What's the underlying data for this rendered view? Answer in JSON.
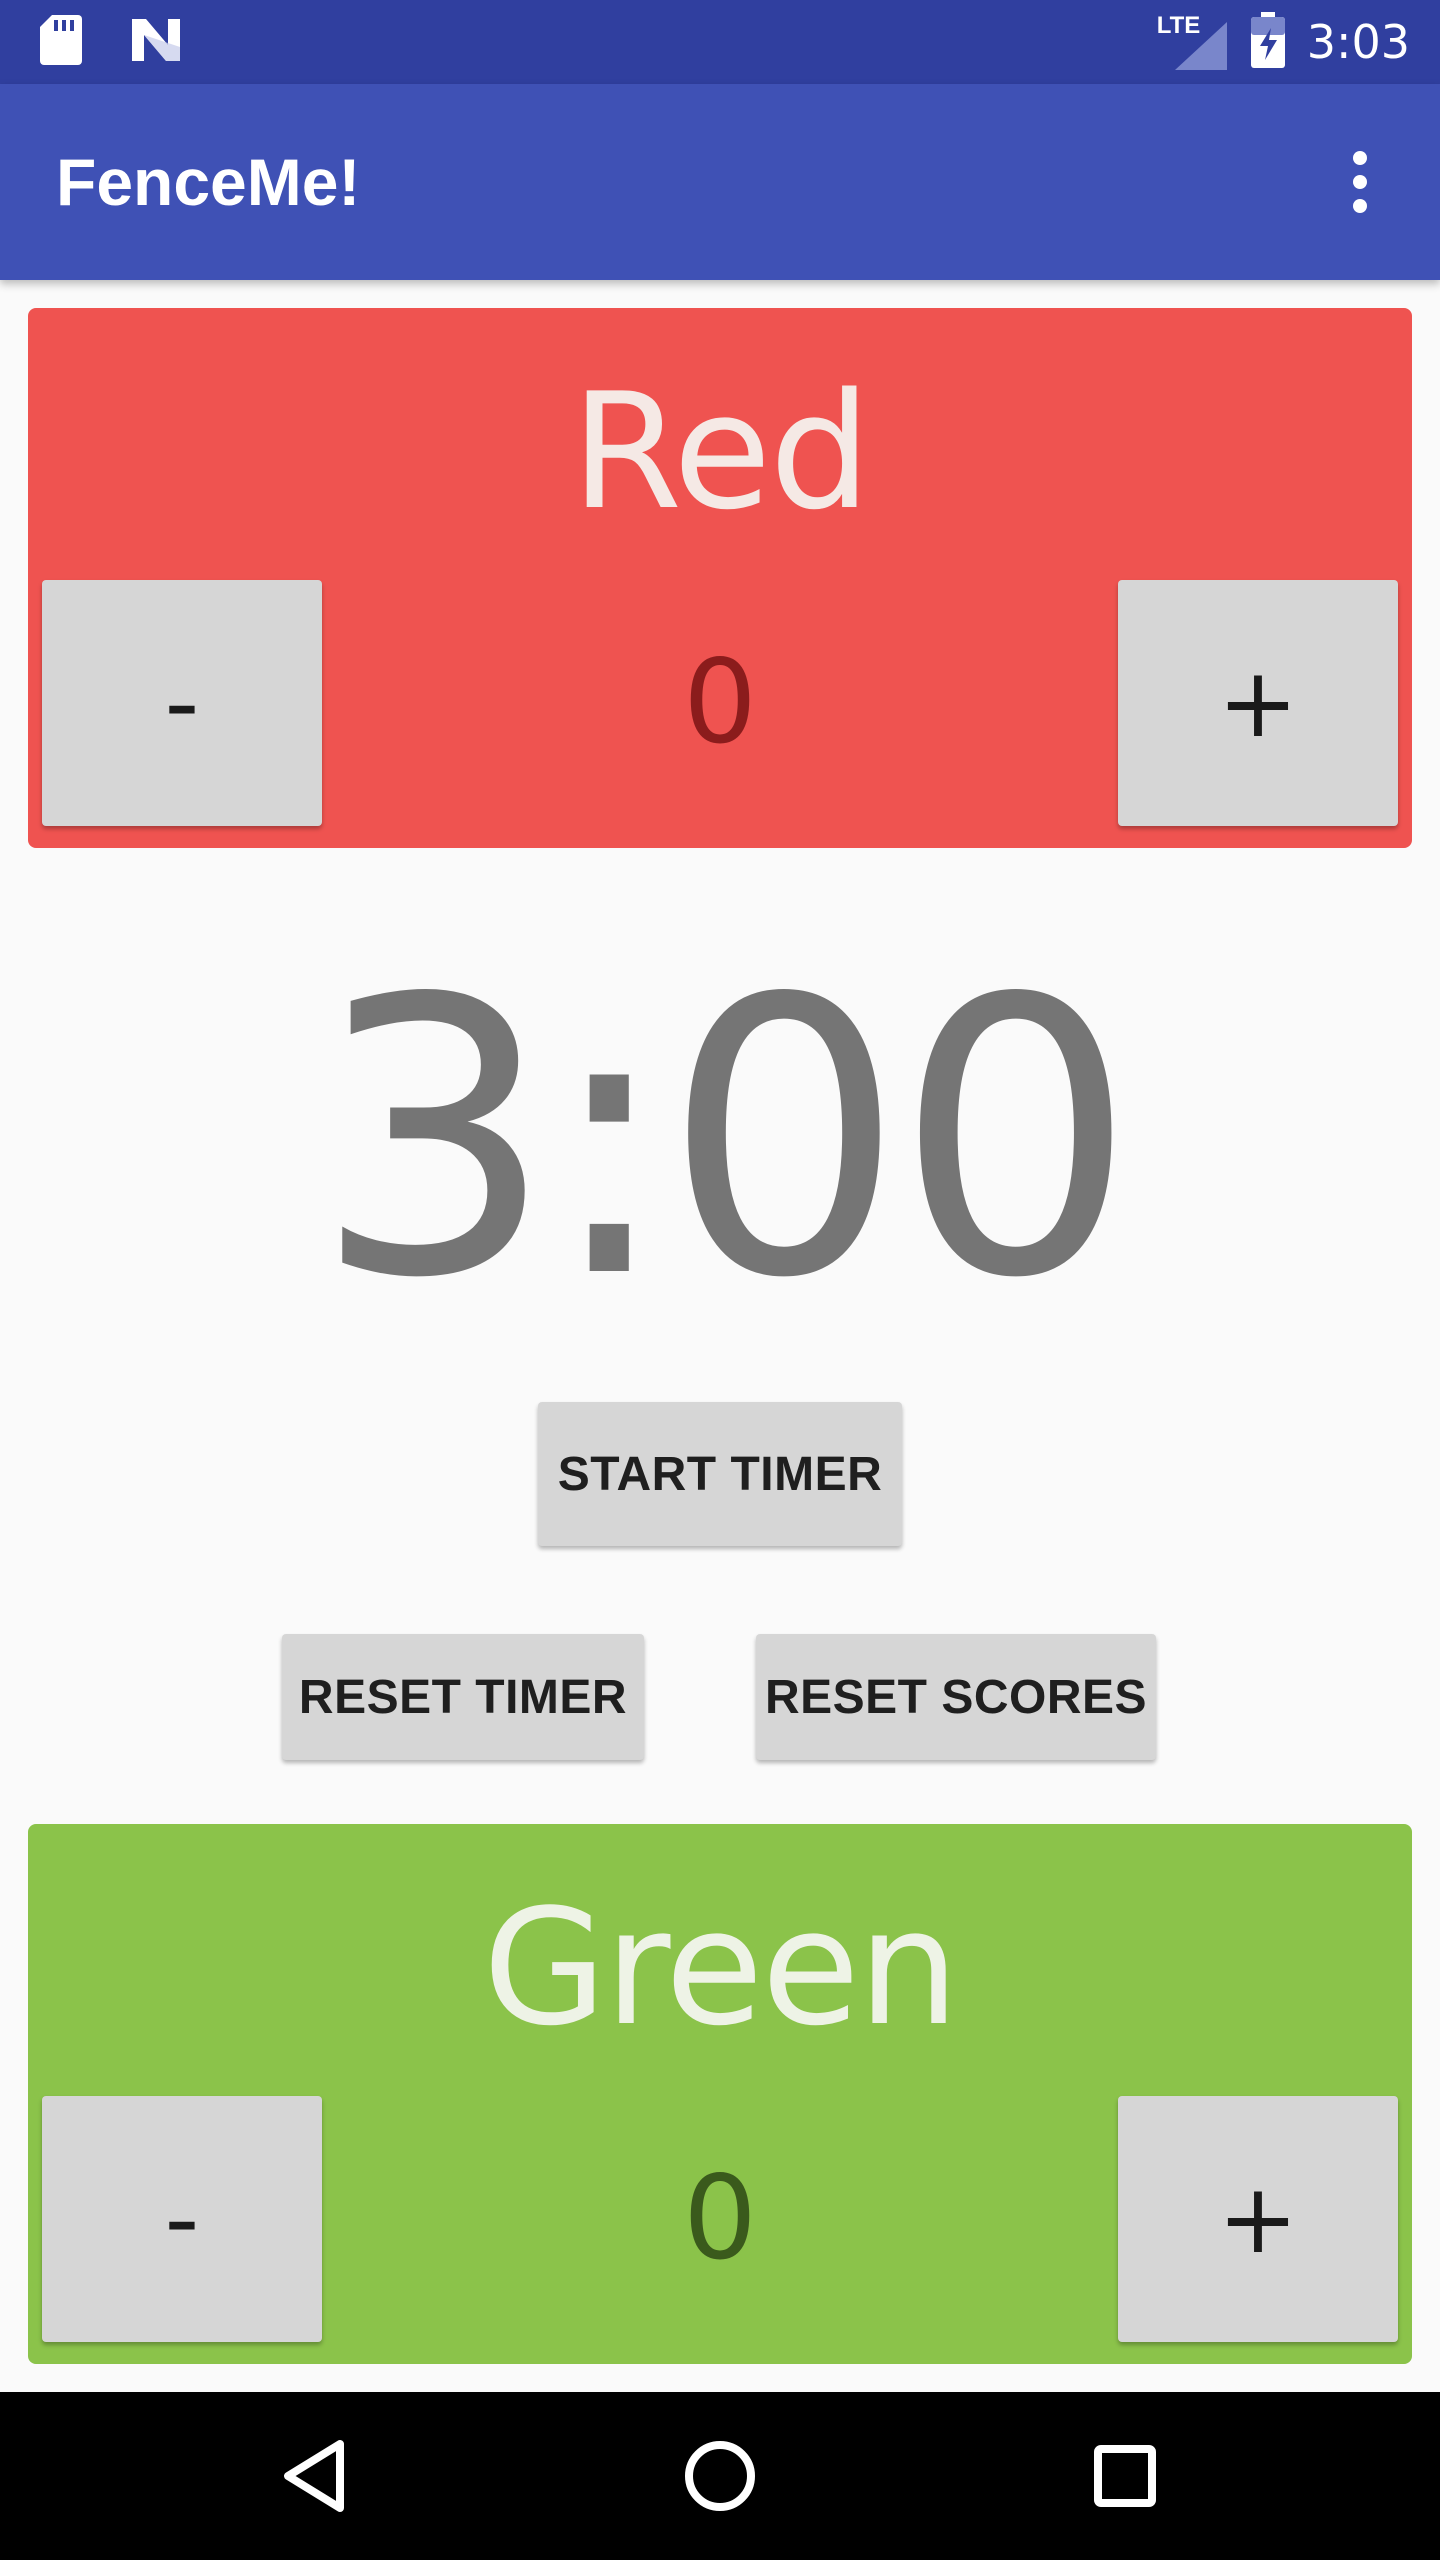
{
  "status_bar": {
    "time": "3:03",
    "network_label": "LTE",
    "icons": [
      "sd-card-icon",
      "n-notification-icon",
      "signal-icon",
      "battery-charging-icon"
    ],
    "background_color": "#303F9F"
  },
  "app_bar": {
    "title": "FenceMe!",
    "menu_icon": "overflow-menu-icon",
    "background_color": "#3F51B5"
  },
  "red_team": {
    "name": "Red",
    "score": "0",
    "minus_label": "-",
    "plus_label": "+",
    "color": "#EF5350"
  },
  "timer": {
    "display": "3:00",
    "start_label": "START TIMER",
    "reset_timer_label": "RESET TIMER",
    "reset_scores_label": "RESET SCORES"
  },
  "green_team": {
    "name": "Green",
    "score": "0",
    "minus_label": "-",
    "plus_label": "+",
    "color": "#8BC34A"
  },
  "nav_bar": {
    "icons": [
      "back-icon",
      "home-icon",
      "recents-icon"
    ]
  }
}
